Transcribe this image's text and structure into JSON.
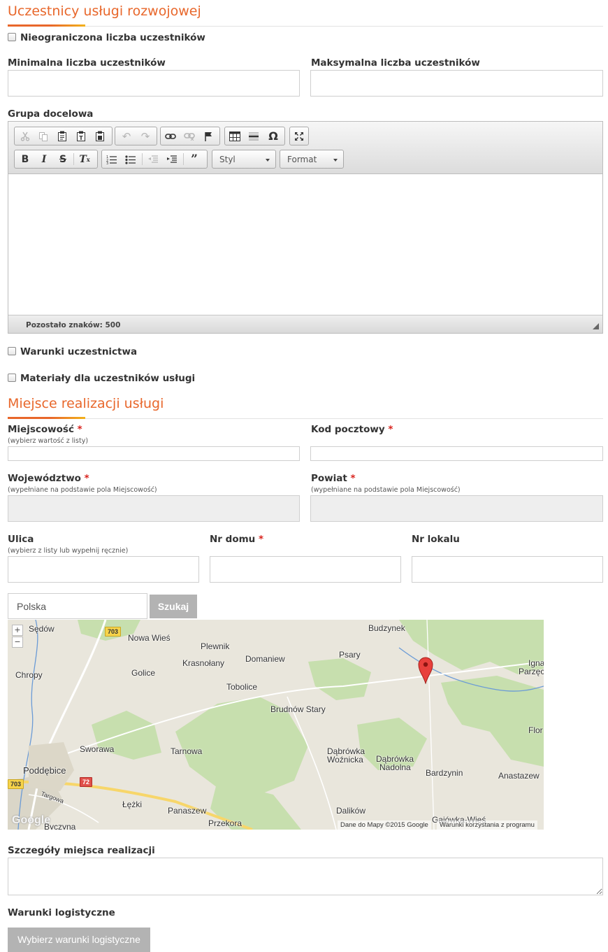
{
  "participants": {
    "title": "Uczestnicy usługi rozwojowej",
    "unlimited_label": "Nieograniczona liczba uczestników",
    "min_label": "Minimalna liczba uczestników",
    "max_label": "Maksymalna liczba uczestników",
    "target_group_label": "Grupa docelowa"
  },
  "editor": {
    "style_combo": "Styl",
    "format_combo": "Format",
    "remaining": "Pozostało znaków: 500"
  },
  "checkboxes": {
    "conditions": "Warunki uczestnictwa",
    "materials": "Materiały dla uczestników usługi"
  },
  "location": {
    "title": "Miejsce realizacji usługi",
    "required_mark": "*",
    "city_label": "Miejscowość",
    "city_hint": "(wybierz wartość z listy)",
    "postal_label": "Kod pocztowy",
    "voivodeship_label": "Województwo",
    "voivodeship_hint": "(wypełniane na podstawie pola Miejscowość)",
    "county_label": "Powiat",
    "county_hint": "(wypełniane na podstawie pola Miejscowość)",
    "street_label": "Ulica",
    "street_hint": "(wybierz z listy lub wypełnij ręcznie)",
    "house_label": "Nr domu",
    "unit_label": "Nr lokalu"
  },
  "map": {
    "search_value": "Polska",
    "search_button": "Szukaj",
    "zoom_in": "+",
    "zoom_out": "−",
    "logo": "Google",
    "attribution": "Dane do Mapy ©2015 Google",
    "terms": "Warunki korzystania z programu",
    "labels": [
      "Sędów",
      "Nowa Wieś",
      "Plewnik",
      "Budzynek",
      "Ignac",
      "Parzęc",
      "Chropy",
      "Krasnołany",
      "Domaniew",
      "Psary",
      "Golice",
      "Tobolice",
      "Brudnów Stary",
      "Flor",
      "Sworawa",
      "Tarnowa",
      "Dąbrówka",
      "Woźnicka",
      "Dąbrówka",
      "Nadolna",
      "Bardzynin",
      "Anastazew",
      "Poddębice",
      "Targowa",
      "Łężki",
      "Panaszew",
      "Przekora",
      "Byczyna",
      "Dalików",
      "Gajówka-Wieś"
    ],
    "road_labels": [
      "703",
      "703",
      "72"
    ],
    "colors": {
      "water": "#6b9bd6",
      "forest": "#c7dfae",
      "land": "#e9e6dc",
      "marker": "#e8403c"
    }
  },
  "details": {
    "label": "Szczegóły miejsca realizacji"
  },
  "logistics": {
    "label": "Warunki logistyczne",
    "button": "Wybierz warunki logistyczne"
  }
}
